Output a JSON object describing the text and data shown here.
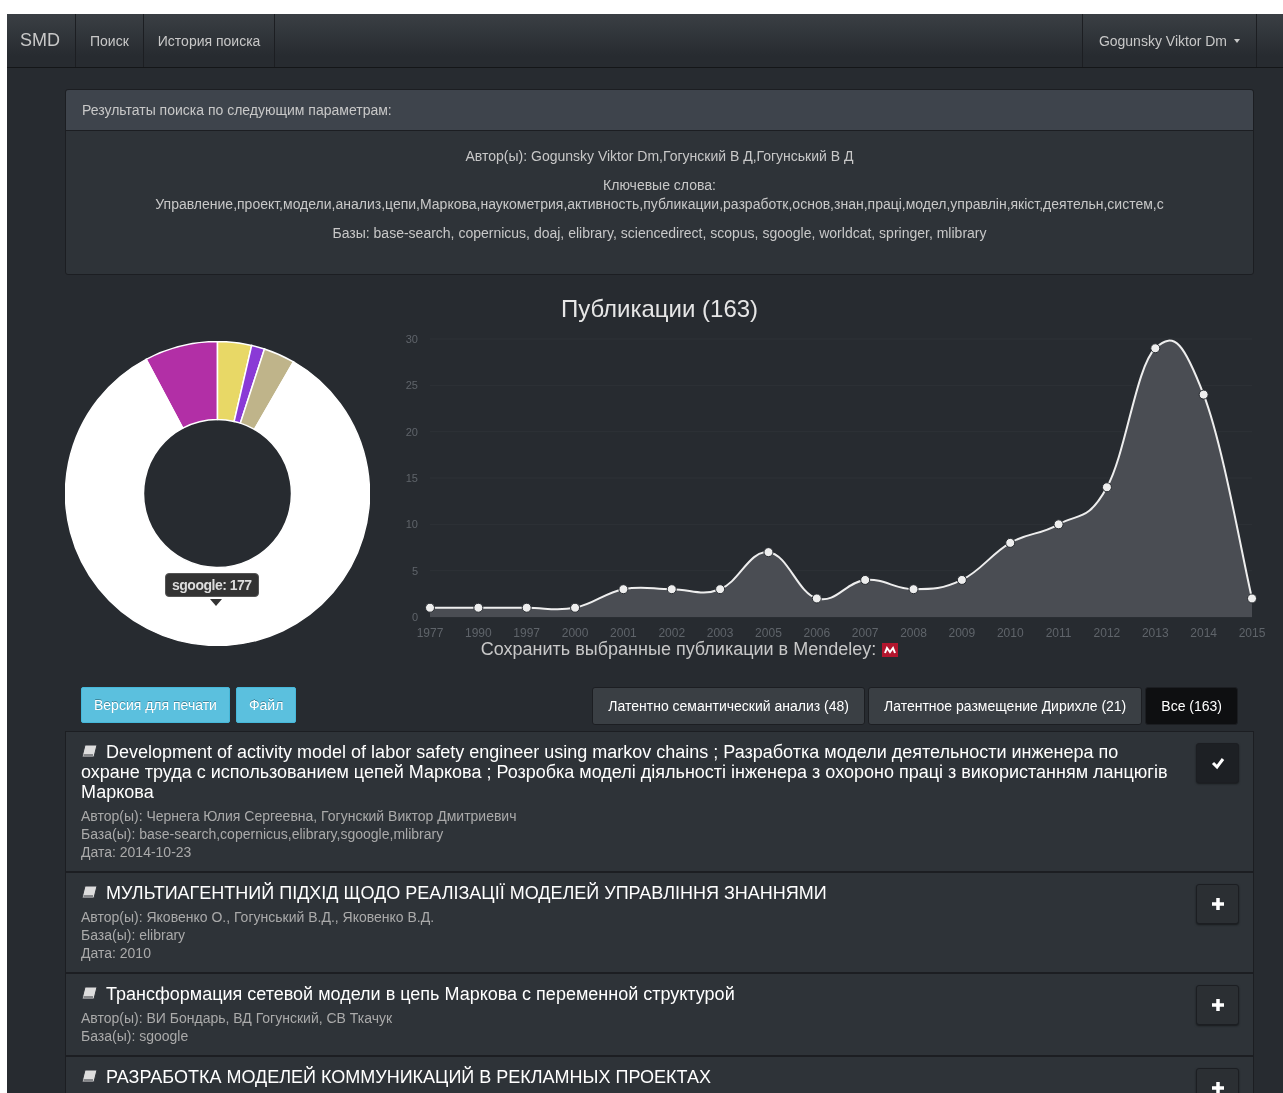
{
  "navbar": {
    "brand": "SMD",
    "items": [
      {
        "label": "Поиск"
      },
      {
        "label": "История поиска"
      }
    ],
    "user": "Gogunsky Viktor Dm"
  },
  "search_panel": {
    "heading": "Результаты поиска по следующим параметрам:",
    "lines": [
      "Автор(ы): Gogunsky Viktor Dm,Гогунский В Д,Гогунський В Д",
      "Ключевые слова:",
      "Управление,проект,модели,анализ,цепи,Маркова,наукометрия,активность,публикации,разработк,основ,знан,праці,модел,управлін,якіст,деятельн,систем,с",
      "Базы: base-search, copernicus, doaj, elibrary, sciencedirect, scopus, sgoogle, worldcat, springer, mlibrary"
    ]
  },
  "publications": {
    "title": "Публикации (163)",
    "donut_tooltip": "sgoogle: 177",
    "chart_data": {
      "type": "area",
      "categories": [
        "1977",
        "1990",
        "1997",
        "2000",
        "2001",
        "2002",
        "2003",
        "2005",
        "2006",
        "2007",
        "2008",
        "2009",
        "2010",
        "2011",
        "2012",
        "2013",
        "2014",
        "2015"
      ],
      "series": [
        {
          "color": "#eeeeee",
          "values": [
            1,
            1,
            1,
            1,
            3,
            3,
            3,
            7,
            2,
            4,
            3,
            4,
            8,
            10,
            14,
            29,
            24,
            2
          ]
        }
      ],
      "ylim": [
        0,
        30
      ],
      "yticks": [
        0,
        5,
        10,
        15,
        20,
        25,
        30
      ]
    },
    "mendeley_label": "Сохранить выбранные публикации в Mendeley:"
  },
  "actions": [
    {
      "label": "Версия для печати"
    },
    {
      "label": "Файл"
    }
  ],
  "filters": [
    {
      "label": "Латентно семантический анализ (48)",
      "selected": false
    },
    {
      "label": "Латентное размещение Дирихле (21)",
      "selected": false
    },
    {
      "label": "Все (163)",
      "selected": true
    }
  ],
  "results": [
    {
      "title": "Development of activity model of labor safety engineer using markov chains ; Разработка модели деятельности инженера по охране труда с использованием цепей Маркова ; Розробка моделі діяльності інженера з охороно праці з використанням ланцюгів Маркова",
      "details": [
        "Автор(ы): Чернега Юлия Сергеевна, Гогунский Виктор Дмитриевич",
        "База(ы): base-search,copernicus,elibrary,sgoogle,mlibrary",
        "Дата: 2014-10-23"
      ],
      "selected": true
    },
    {
      "title": "МУЛЬТИАГЕНТНИЙ ПІДХІД ЩОДО РЕАЛІЗАЦІЇ МОДЕЛЕЙ УПРАВЛІННЯ ЗНАННЯМИ",
      "details": [
        "Автор(ы): Яковенко О., Гогунський В.Д., Яковенко В.Д.",
        "База(ы): elibrary",
        "Дата: 2010"
      ],
      "selected": false
    },
    {
      "title": "Трансформация сетевой модели в цепь Маркова с переменной структурой",
      "details": [
        "Автор(ы): ВИ Бондарь, ВД Гогунский, СВ Ткачук",
        "База(ы): sgoogle"
      ],
      "selected": false
    },
    {
      "title": "РАЗРАБОТКА МОДЕЛЕЙ КОММУНИКАЦИЙ В РЕКЛАМНЫХ ПРОЕКТАХ",
      "selected": false
    }
  ]
}
